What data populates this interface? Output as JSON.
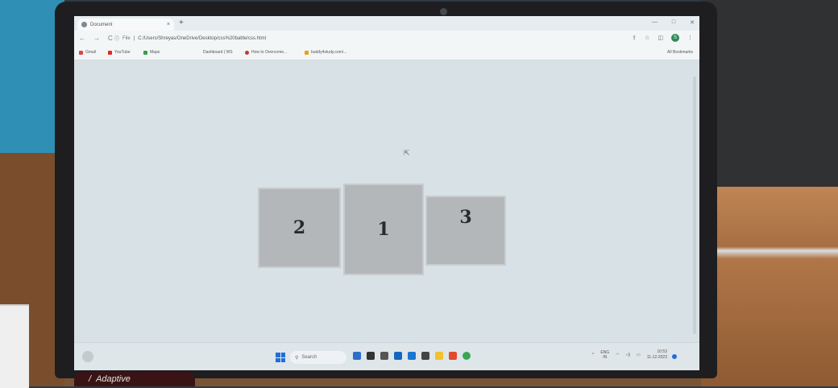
{
  "browser": {
    "tab_title": "Document",
    "tab_close": "×",
    "new_tab": "+",
    "window_controls": [
      "—",
      "□",
      "✕"
    ],
    "nav": [
      "←",
      "→",
      "C"
    ],
    "url_prefix": "File",
    "url": "C:/Users/Shreyas/OneDrive/Desktop/css%20battle/css.html",
    "profile_initial": "S",
    "bookmarks": [
      "Gmail",
      "YouTube",
      "Maps",
      "Dashboard | WS",
      "How to Overcome...",
      "buddy4study.com/..."
    ],
    "all_bookmarks": "All Bookmarks"
  },
  "page": {
    "boxes": [
      {
        "label": "2"
      },
      {
        "label": "1"
      },
      {
        "label": "3"
      }
    ]
  },
  "taskbar": {
    "search_placeholder": "Search",
    "tray_lang": [
      "ENG",
      "IN"
    ],
    "tray_time": "10:53",
    "tray_date": "11-12-2023"
  },
  "laptop": {
    "brand_text": "Adaptive"
  },
  "colors": {
    "box_fill": "#b3b7ba",
    "page_bg": "#d8e1e5",
    "start_blue": "#1e6fd9"
  }
}
